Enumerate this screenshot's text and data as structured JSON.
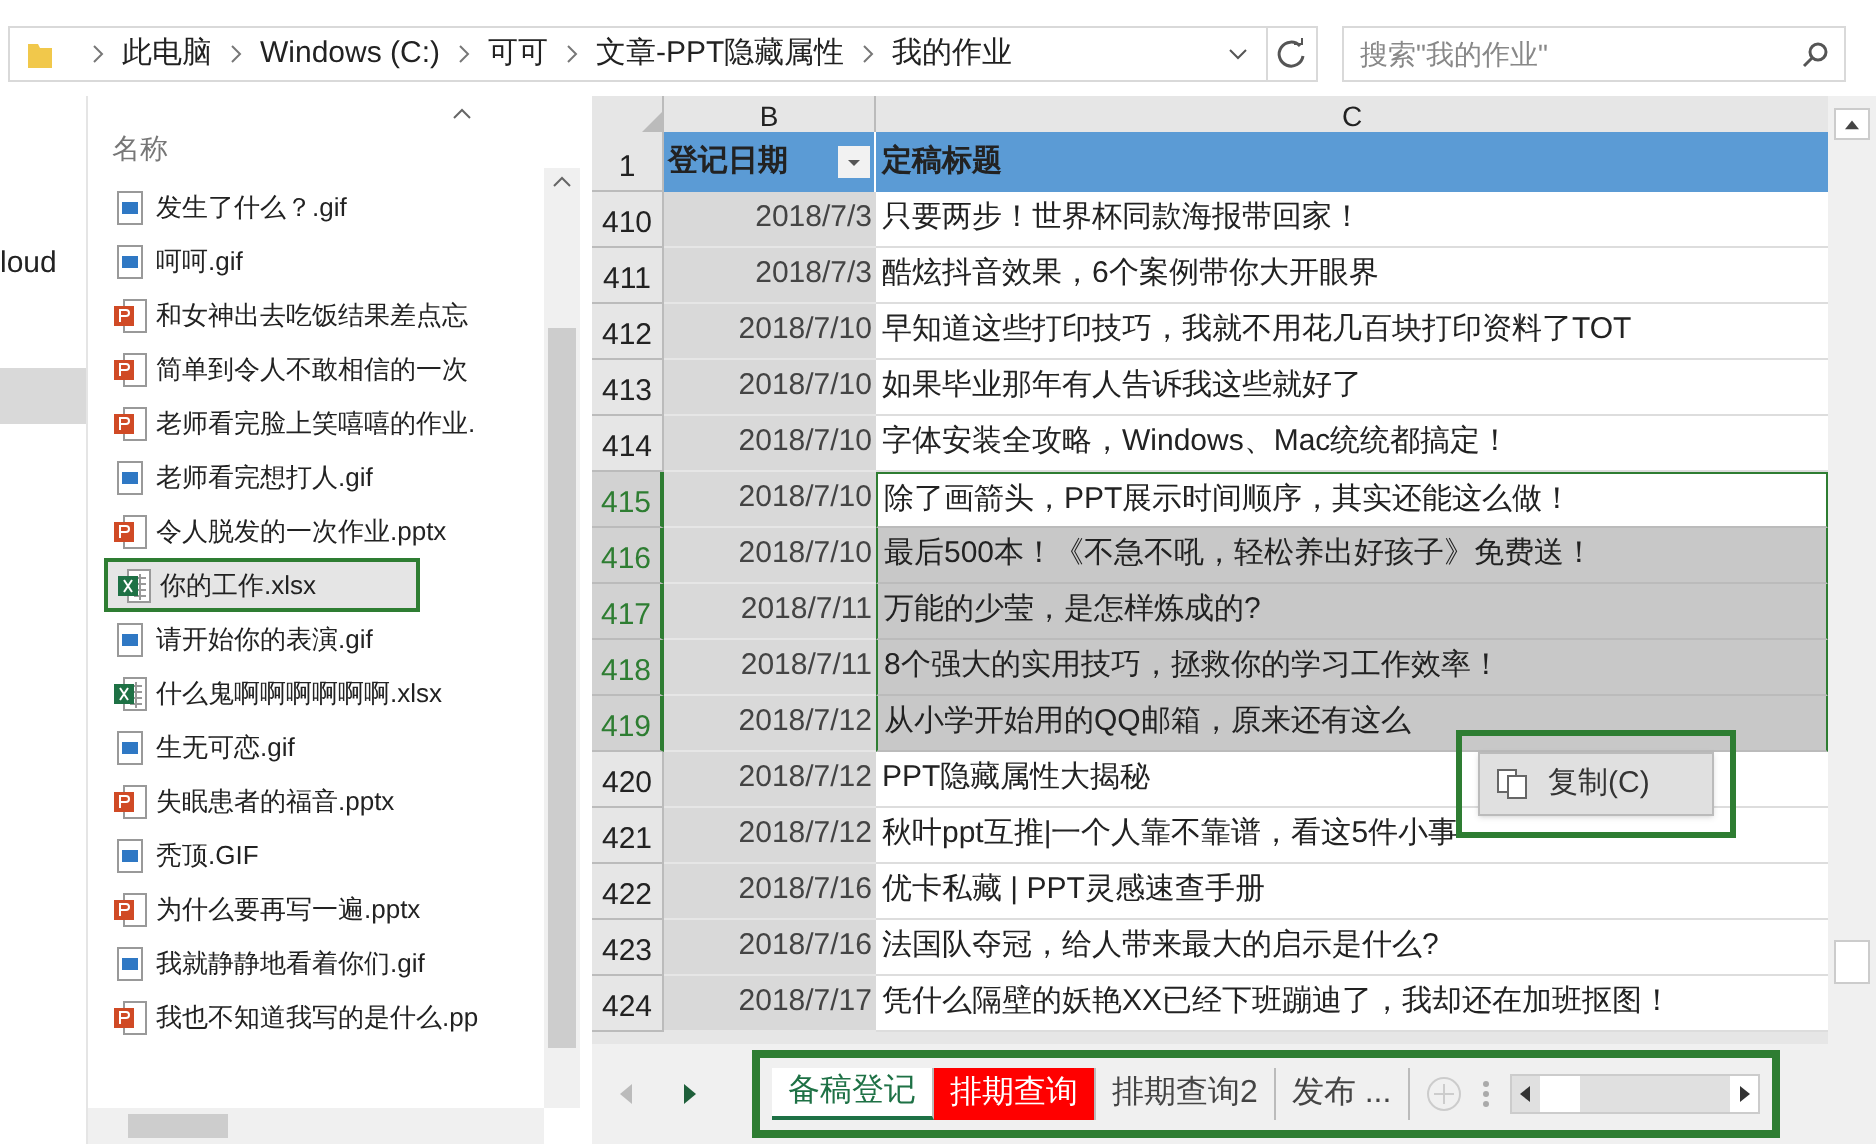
{
  "breadcrumb": {
    "items": [
      "此电脑",
      "Windows (C:)",
      "可可",
      "文章-PPT隐藏属性",
      "我的作业"
    ]
  },
  "search": {
    "placeholder": "搜索\"我的作业\""
  },
  "nav_pane": {
    "items": [
      {
        "label": "loud",
        "selected": false
      },
      {
        "selected": true
      }
    ]
  },
  "file_list": {
    "column": "名称",
    "files": [
      {
        "name": "发生了什么？.gif",
        "kind": "gif",
        "selected": false
      },
      {
        "name": "呵呵.gif",
        "kind": "gif",
        "selected": false
      },
      {
        "name": "和女神出去吃饭结果差点忘",
        "kind": "pptx",
        "selected": false
      },
      {
        "name": "简单到令人不敢相信的一次",
        "kind": "pptx",
        "selected": false
      },
      {
        "name": "老师看完脸上笑嘻嘻的作业.",
        "kind": "pptx",
        "selected": false
      },
      {
        "name": "老师看完想打人.gif",
        "kind": "gif",
        "selected": false
      },
      {
        "name": "令人脱发的一次作业.pptx",
        "kind": "pptx",
        "selected": false
      },
      {
        "name": "你的工作.xlsx",
        "kind": "xlsx",
        "selected": true
      },
      {
        "name": "请开始你的表演.gif",
        "kind": "gif",
        "selected": false
      },
      {
        "name": "什么鬼啊啊啊啊啊啊.xlsx",
        "kind": "xlsx",
        "selected": false
      },
      {
        "name": "生无可恋.gif",
        "kind": "gif",
        "selected": false
      },
      {
        "name": "失眠患者的福音.pptx",
        "kind": "pptx",
        "selected": false
      },
      {
        "name": "秃顶.GIF",
        "kind": "gif",
        "selected": false
      },
      {
        "name": "为什么要再写一遍.pptx",
        "kind": "pptx",
        "selected": false
      },
      {
        "name": "我就静静地看着你们.gif",
        "kind": "gif",
        "selected": false
      },
      {
        "name": "我也不知道我写的是什么.pp",
        "kind": "pptx",
        "selected": false
      }
    ]
  },
  "sheet": {
    "columns": [
      "B",
      "C"
    ],
    "header": {
      "row": "1",
      "date": "登记日期",
      "title": "定稿标题"
    },
    "rows": [
      {
        "row": "410",
        "date": "2018/7/3",
        "title": "只要两步！世界杯同款海报带回家！",
        "selected": false
      },
      {
        "row": "411",
        "date": "2018/7/3",
        "title": "酷炫抖音效果，6个案例带你大开眼界",
        "selected": false
      },
      {
        "row": "412",
        "date": "2018/7/10",
        "title": "早知道这些打印技巧，我就不用花几百块打印资料了TOT",
        "selected": false
      },
      {
        "row": "413",
        "date": "2018/7/10",
        "title": "如果毕业那年有人告诉我这些就好了",
        "selected": false
      },
      {
        "row": "414",
        "date": "2018/7/10",
        "title": "字体安装全攻略，Windows、Mac统统都搞定！",
        "selected": false
      },
      {
        "row": "415",
        "date": "2018/7/10",
        "title": "除了画箭头，PPT展示时间顺序，其实还能这么做！",
        "selected": true
      },
      {
        "row": "416",
        "date": "2018/7/10",
        "title": "最后500本！《不急不吼，轻松养出好孩子》免费送！",
        "selected": true
      },
      {
        "row": "417",
        "date": "2018/7/11",
        "title": "万能的少莹，是怎样炼成的?",
        "selected": true
      },
      {
        "row": "418",
        "date": "2018/7/11",
        "title": "8个强大的实用技巧，拯救你的学习工作效率！",
        "selected": true
      },
      {
        "row": "419",
        "date": "2018/7/12",
        "title": "从小学开始用的QQ邮箱，原来还有这么",
        "selected": true
      },
      {
        "row": "420",
        "date": "2018/7/12",
        "title": "PPT隐藏属性大揭秘",
        "selected": false
      },
      {
        "row": "421",
        "date": "2018/7/12",
        "title": "秋叶ppt互推|一个人靠不靠谱，看这5件小事",
        "selected": false
      },
      {
        "row": "422",
        "date": "2018/7/16",
        "title": "优卡私藏 | PPT灵感速查手册",
        "selected": false
      },
      {
        "row": "423",
        "date": "2018/7/16",
        "title": "法国队夺冠，给人带来最大的启示是什么?",
        "selected": false
      },
      {
        "row": "424",
        "date": "2018/7/17",
        "title": "凭什么隔壁的妖艳XX已经下班蹦迪了，我却还在加班抠图！",
        "selected": false
      }
    ]
  },
  "context_menu": {
    "items": [
      "复制(C)"
    ]
  },
  "sheet_tabs": [
    {
      "label": "备稿登记",
      "selected": true
    },
    {
      "label": "排期查询",
      "selected": false,
      "color": "#ff0000"
    },
    {
      "label": "排期查询2",
      "selected": false
    },
    {
      "label": "发布 ...",
      "selected": false
    }
  ]
}
